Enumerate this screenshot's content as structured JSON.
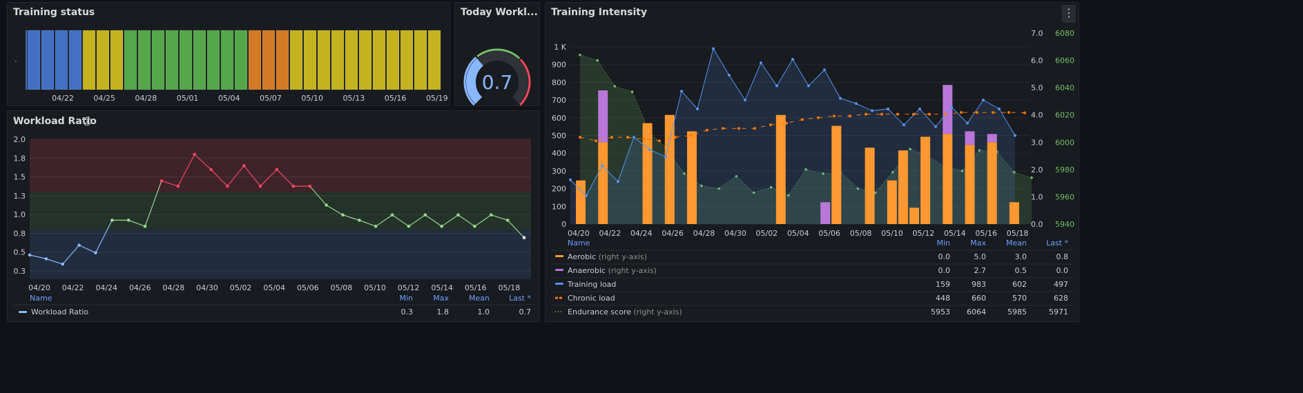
{
  "panels": {
    "training_status": {
      "title": "Training status",
      "dot": "·"
    },
    "today_workload": {
      "title": "Today Workl..."
    },
    "workload_ratio": {
      "title": "Workload Ratio"
    },
    "training_intensity": {
      "title": "Training Intensity"
    }
  },
  "icons": {
    "info": "info-icon",
    "menu": "kebab-menu-icon"
  },
  "colors": {
    "blue": "#4470c4",
    "yellow": "#c4b21f",
    "green": "#56a64b",
    "orange": "#d27a25",
    "aerobic": "#ff9830",
    "anaerobic": "#b877d9",
    "training_load": "#5794f2",
    "chronic": "#ff780a",
    "endurance": "#73bf69",
    "red_line": "#f2495c",
    "green_line": "#96d98d",
    "blue_line": "#8ab8ff"
  },
  "gauge": {
    "value": "0.7",
    "fraction": 0.35
  },
  "legend_headers": {
    "name": "Name",
    "min": "Min",
    "max": "Max",
    "mean": "Mean",
    "last": "Last *"
  },
  "chart_data": [
    {
      "type": "state-timeline",
      "title": "Training status",
      "xlabels": [
        "04/22",
        "04/25",
        "04/28",
        "05/01",
        "05/04",
        "05/07",
        "05/10",
        "05/13",
        "05/16",
        "05/19"
      ],
      "states": [
        "blue",
        "blue",
        "blue",
        "blue",
        "yellow",
        "yellow",
        "yellow",
        "green",
        "green",
        "green",
        "green",
        "green",
        "green",
        "green",
        "green",
        "green",
        "orange",
        "orange",
        "orange",
        "yellow",
        "yellow",
        "yellow",
        "yellow",
        "yellow",
        "yellow",
        "yellow",
        "yellow",
        "yellow",
        "yellow",
        "yellow"
      ]
    },
    {
      "type": "line",
      "title": "Workload Ratio",
      "y_ticks": [
        "2.0",
        "1.8",
        "1.5",
        "1.3",
        "1.0",
        "0.8",
        "0.5",
        "0.3"
      ],
      "ylim": [
        0.15,
        2.0
      ],
      "x_labels": [
        "04/20",
        "04/22",
        "04/24",
        "04/26",
        "04/28",
        "04/30",
        "05/02",
        "05/04",
        "05/06",
        "05/08",
        "05/10",
        "05/12",
        "05/14",
        "05/16",
        "05/18"
      ],
      "thresholds": [
        1.3,
        0.8
      ],
      "values": [
        0.47,
        0.42,
        0.35,
        0.6,
        0.5,
        0.93,
        0.93,
        0.85,
        1.45,
        1.38,
        1.8,
        1.6,
        1.38,
        1.65,
        1.38,
        1.6,
        1.38,
        1.38,
        1.13,
        1.0,
        0.93,
        0.85,
        1.0,
        0.85,
        1.0,
        0.85,
        1.0,
        0.85,
        1.0,
        0.93,
        0.7
      ],
      "legend": [
        {
          "name": "Workload Ratio",
          "min": "0.3",
          "max": "1.8",
          "mean": "1.0",
          "last": "0.7"
        }
      ]
    },
    {
      "type": "bar+line",
      "title": "Training Intensity",
      "left_ticks": [
        "1 K",
        "900",
        "800",
        "700",
        "600",
        "500",
        "400",
        "300",
        "200",
        "100",
        "0"
      ],
      "right_ticks_1": [
        "7.0",
        "6.0",
        "5.0",
        "4.0",
        "3.0",
        "2.0",
        "1.0",
        "0.0"
      ],
      "right_ticks_2": [
        "6080",
        "6060",
        "6040",
        "6020",
        "6000",
        "5980",
        "5960",
        "5940"
      ],
      "x_labels": [
        "04/20",
        "04/22",
        "04/24",
        "04/26",
        "04/28",
        "04/30",
        "05/02",
        "05/04",
        "05/06",
        "05/08",
        "05/10",
        "05/12",
        "05/14",
        "05/16",
        "05/18"
      ],
      "aerobic": [
        1.6,
        0,
        3.0,
        0,
        0,
        0,
        3.7,
        0,
        4.0,
        0,
        3.4,
        0,
        0,
        0,
        0,
        0,
        0,
        0,
        4.0,
        0,
        0,
        0,
        0,
        3.6,
        0,
        0,
        2.8,
        0,
        1.6,
        2.7,
        0.6,
        3.2,
        0,
        3.3,
        0,
        2.9,
        0,
        3.0,
        0,
        0.8
      ],
      "anaerobic": [
        0,
        0,
        1.9,
        0,
        0,
        0,
        0,
        0,
        0,
        0,
        0,
        0,
        0,
        0,
        0,
        0,
        0,
        0,
        0,
        0,
        0,
        0,
        0.8,
        0,
        0,
        0,
        0,
        0,
        0,
        0,
        0,
        0,
        0,
        1.8,
        0,
        0.5,
        0,
        0.3,
        0,
        0
      ],
      "training_load": [
        250,
        160,
        330,
        240,
        490,
        420,
        380,
        750,
        650,
        990,
        840,
        700,
        910,
        780,
        930,
        780,
        870,
        710,
        680,
        640,
        650,
        560,
        650,
        550,
        660,
        570,
        700,
        650,
        500
      ],
      "chronic_load": [
        490,
        470,
        490,
        490,
        480,
        470,
        490,
        500,
        530,
        540,
        540,
        540,
        560,
        570,
        590,
        600,
        610,
        610,
        620,
        620,
        620,
        620,
        620,
        620,
        630,
        630,
        630,
        630,
        628
      ],
      "endurance": [
        6064,
        6060,
        6041,
        6037,
        6007,
        5995,
        5977,
        5968,
        5966,
        5975,
        5963,
        5967,
        5961,
        5980,
        5977,
        5978,
        5966,
        5963,
        5978,
        5995,
        5990,
        5982,
        5979,
        5994,
        5993,
        5978,
        5974
      ],
      "legend": [
        {
          "name": "Aerobic",
          "note": "(right y-axis)",
          "min": "0.0",
          "max": "5.0",
          "mean": "3.0",
          "last": "0.8"
        },
        {
          "name": "Anaerobic",
          "note": "(right y-axis)",
          "min": "0.0",
          "max": "2.7",
          "mean": "0.5",
          "last": "0.0"
        },
        {
          "name": "Training load",
          "note": "",
          "min": "159",
          "max": "983",
          "mean": "602",
          "last": "497"
        },
        {
          "name": "Chronic load",
          "note": "",
          "min": "448",
          "max": "660",
          "mean": "570",
          "last": "628"
        },
        {
          "name": "Endurance score",
          "note": "(right y-axis)",
          "min": "5953",
          "max": "6064",
          "mean": "5985",
          "last": "5971"
        }
      ]
    }
  ]
}
